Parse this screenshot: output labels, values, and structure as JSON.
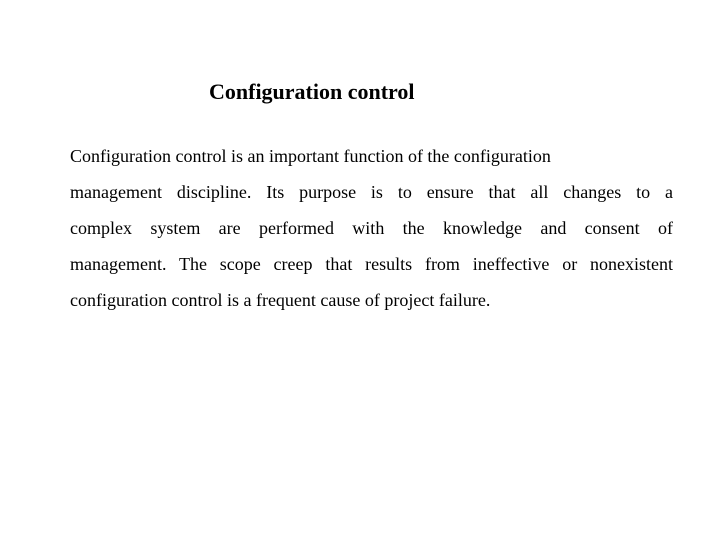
{
  "slide": {
    "title": "Configuration control",
    "body_lines": [
      "Configuration control is an important function of the configuration",
      "management discipline. Its purpose is to ensure that all changes to a",
      "complex system are performed with the knowledge and consent of",
      "management. The scope creep that results from ineffective or nonexistent",
      "configuration control is a frequent cause of project failure."
    ]
  }
}
